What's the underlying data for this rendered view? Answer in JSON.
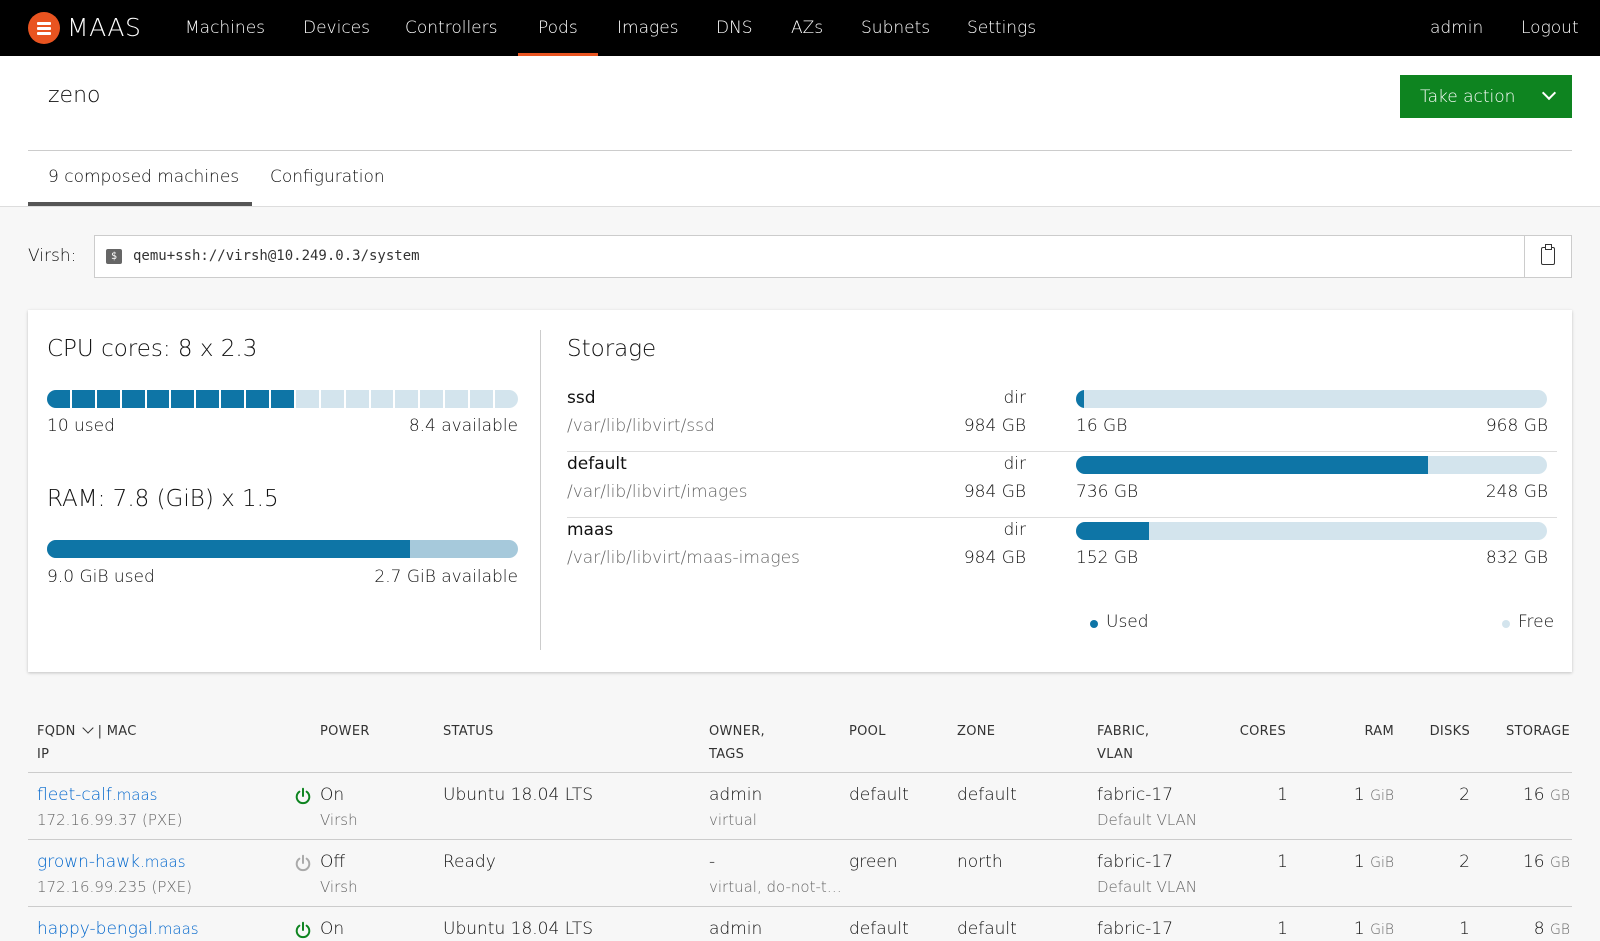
{
  "nav": {
    "brand": "MAAS",
    "items": [
      "Machines",
      "Devices",
      "Controllers",
      "Pods",
      "Images",
      "DNS",
      "AZs",
      "Subnets",
      "Settings"
    ],
    "active": "Pods",
    "user": "admin",
    "logout": "Logout"
  },
  "header": {
    "title": "zeno",
    "action_label": "Take action",
    "tabs": [
      "9 composed machines",
      "Configuration"
    ]
  },
  "virsh": {
    "label": "Virsh:",
    "address": "qemu+ssh://virsh@10.249.0.3/system"
  },
  "resources": {
    "cpu": {
      "title": "CPU cores: 8 x 2.3",
      "used_label": "10 used",
      "available_label": "8.4 available",
      "used_segments": 10,
      "total_segments": 19
    },
    "ram": {
      "title": "RAM: 7.8 (GiB) x 1.5",
      "used_label": "9.0 GiB used",
      "available_label": "2.7 GiB available",
      "used_fraction": 0.77
    },
    "storage_title": "Storage",
    "pools": [
      {
        "name": "ssd",
        "type": "dir",
        "path": "/var/lib/libvirt/ssd",
        "size": "984 GB",
        "used": "16 GB",
        "free": "968 GB",
        "used_fraction": 0.016
      },
      {
        "name": "default",
        "type": "dir",
        "path": "/var/lib/libvirt/images",
        "size": "984 GB",
        "used": "736 GB",
        "free": "248 GB",
        "used_fraction": 0.748
      },
      {
        "name": "maas",
        "type": "dir",
        "path": "/var/lib/libvirt/maas-images",
        "size": "984 GB",
        "used": "152 GB",
        "free": "832 GB",
        "used_fraction": 0.154
      }
    ],
    "legend": {
      "used": "Used",
      "free": "Free"
    }
  },
  "table": {
    "headers": {
      "fqdn": "FQDN",
      "mac": "| MAC",
      "ip": "IP",
      "power": "POWER",
      "status": "STATUS",
      "owner": "OWNER,",
      "tags": "TAGS",
      "pool": "POOL",
      "zone": "ZONE",
      "fabric": "FABRIC,",
      "vlan": "VLAN",
      "cores": "CORES",
      "ram": "RAM",
      "disks": "DISKS",
      "storage": "STORAGE"
    },
    "rows": [
      {
        "host": "fleet-calf",
        "domain": ".maas",
        "ip": "172.16.99.37 (PXE)",
        "power": "On",
        "power_type": "Virsh",
        "status": "Ubuntu 18.04 LTS",
        "owner": "admin",
        "tags": "virtual",
        "pool": "default",
        "zone": "default",
        "fabric": "fabric-17",
        "vlan": "Default VLAN",
        "cores": "1",
        "ram": "1",
        "ram_unit": "GiB",
        "disks": "2",
        "storage": "16",
        "storage_unit": "GB"
      },
      {
        "host": "grown-hawk",
        "domain": ".maas",
        "ip": "172.16.99.235 (PXE)",
        "power": "Off",
        "power_type": "Virsh",
        "status": "Ready",
        "owner": "-",
        "tags": "virtual, do-not-t…",
        "pool": "green",
        "zone": "north",
        "fabric": "fabric-17",
        "vlan": "Default VLAN",
        "cores": "1",
        "ram": "1",
        "ram_unit": "GiB",
        "disks": "2",
        "storage": "16",
        "storage_unit": "GB"
      },
      {
        "host": "happy-bengal",
        "domain": ".maas",
        "ip": "",
        "power": "On",
        "power_type": "",
        "status": "Ubuntu 18.04 LTS",
        "owner": "admin",
        "tags": "",
        "pool": "default",
        "zone": "default",
        "fabric": "fabric-17",
        "vlan": "",
        "cores": "1",
        "ram": "1",
        "ram_unit": "GiB",
        "disks": "1",
        "storage": "8",
        "storage_unit": "GB"
      }
    ]
  },
  "colors": {
    "accent": "#e95420",
    "action": "#0e8420",
    "used": "#0e75a6",
    "free": "#d3e4ed",
    "power_on": "#0e8420",
    "power_off": "#aaaaaa",
    "link": "#0066cc"
  }
}
